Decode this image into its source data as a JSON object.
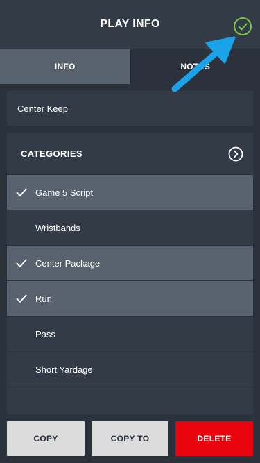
{
  "header": {
    "title": "PLAY INFO",
    "confirm_icon": "check-circle-icon",
    "confirm_color": "#7ac943"
  },
  "tabs": [
    {
      "label": "INFO",
      "active": true
    },
    {
      "label": "NOTES",
      "active": false
    }
  ],
  "play_name": "Center Keep",
  "categories": {
    "title": "CATEGORIES",
    "arrow_icon": "chevron-right-circle-icon",
    "items": [
      {
        "label": "Game 5 Script",
        "selected": true
      },
      {
        "label": "Wristbands",
        "selected": false
      },
      {
        "label": "Center Package",
        "selected": true
      },
      {
        "label": "Run",
        "selected": true
      },
      {
        "label": "Pass",
        "selected": false
      },
      {
        "label": "Short Yardage",
        "selected": false
      }
    ]
  },
  "footer": {
    "copy_label": "COPY",
    "copy_to_label": "COPY TO",
    "delete_label": "DELETE",
    "delete_color": "#e8050d"
  },
  "annotation": {
    "icon": "pointer-arrow-icon",
    "color": "#1aa3e8"
  }
}
